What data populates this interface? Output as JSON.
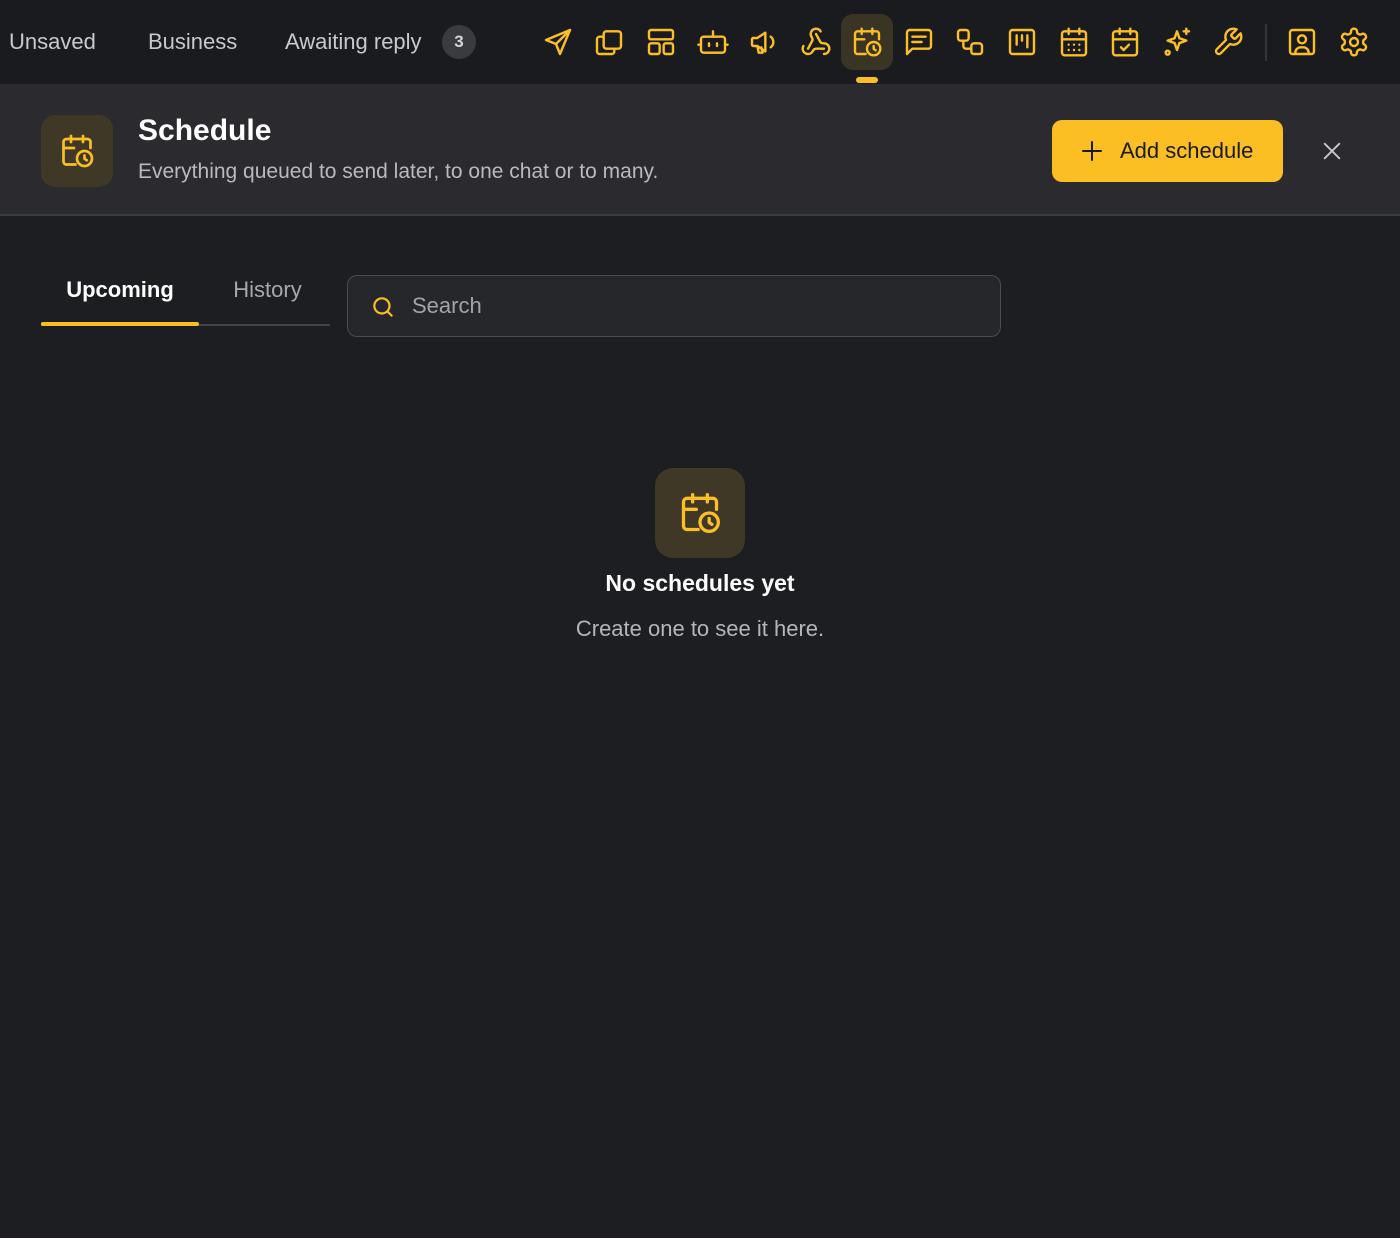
{
  "topbar": {
    "filters": {
      "unsaved": "Unsaved",
      "business": "Business",
      "awaiting_reply": "Awaiting reply",
      "awaiting_reply_count": "3"
    },
    "tools": [
      "send-icon",
      "copy-icon",
      "layout-icon",
      "bot-icon",
      "megaphone-icon",
      "webhook-icon",
      "calendar-clock-icon",
      "message-square-icon",
      "workflow-icon",
      "kanban-icon",
      "calendar-grid-icon",
      "calendar-check-icon",
      "sparkles-icon",
      "wrench-icon",
      "contact-icon",
      "gear-icon"
    ],
    "active_tool": "calendar-clock-icon"
  },
  "header": {
    "title": "Schedule",
    "subtitle": "Everything queued to send later, to one chat or to many.",
    "add_button_label": "Add schedule"
  },
  "tabs": {
    "upcoming": "Upcoming",
    "history": "History",
    "active": "Upcoming"
  },
  "search": {
    "placeholder": "Search",
    "value": ""
  },
  "empty_state": {
    "title": "No schedules yet",
    "text": "Create one to see it here."
  },
  "colors": {
    "accent": "#fbbf24",
    "background": "#1d1e21",
    "header_bg": "#2a2a2f",
    "topbar_bg": "#1a1b1e"
  }
}
